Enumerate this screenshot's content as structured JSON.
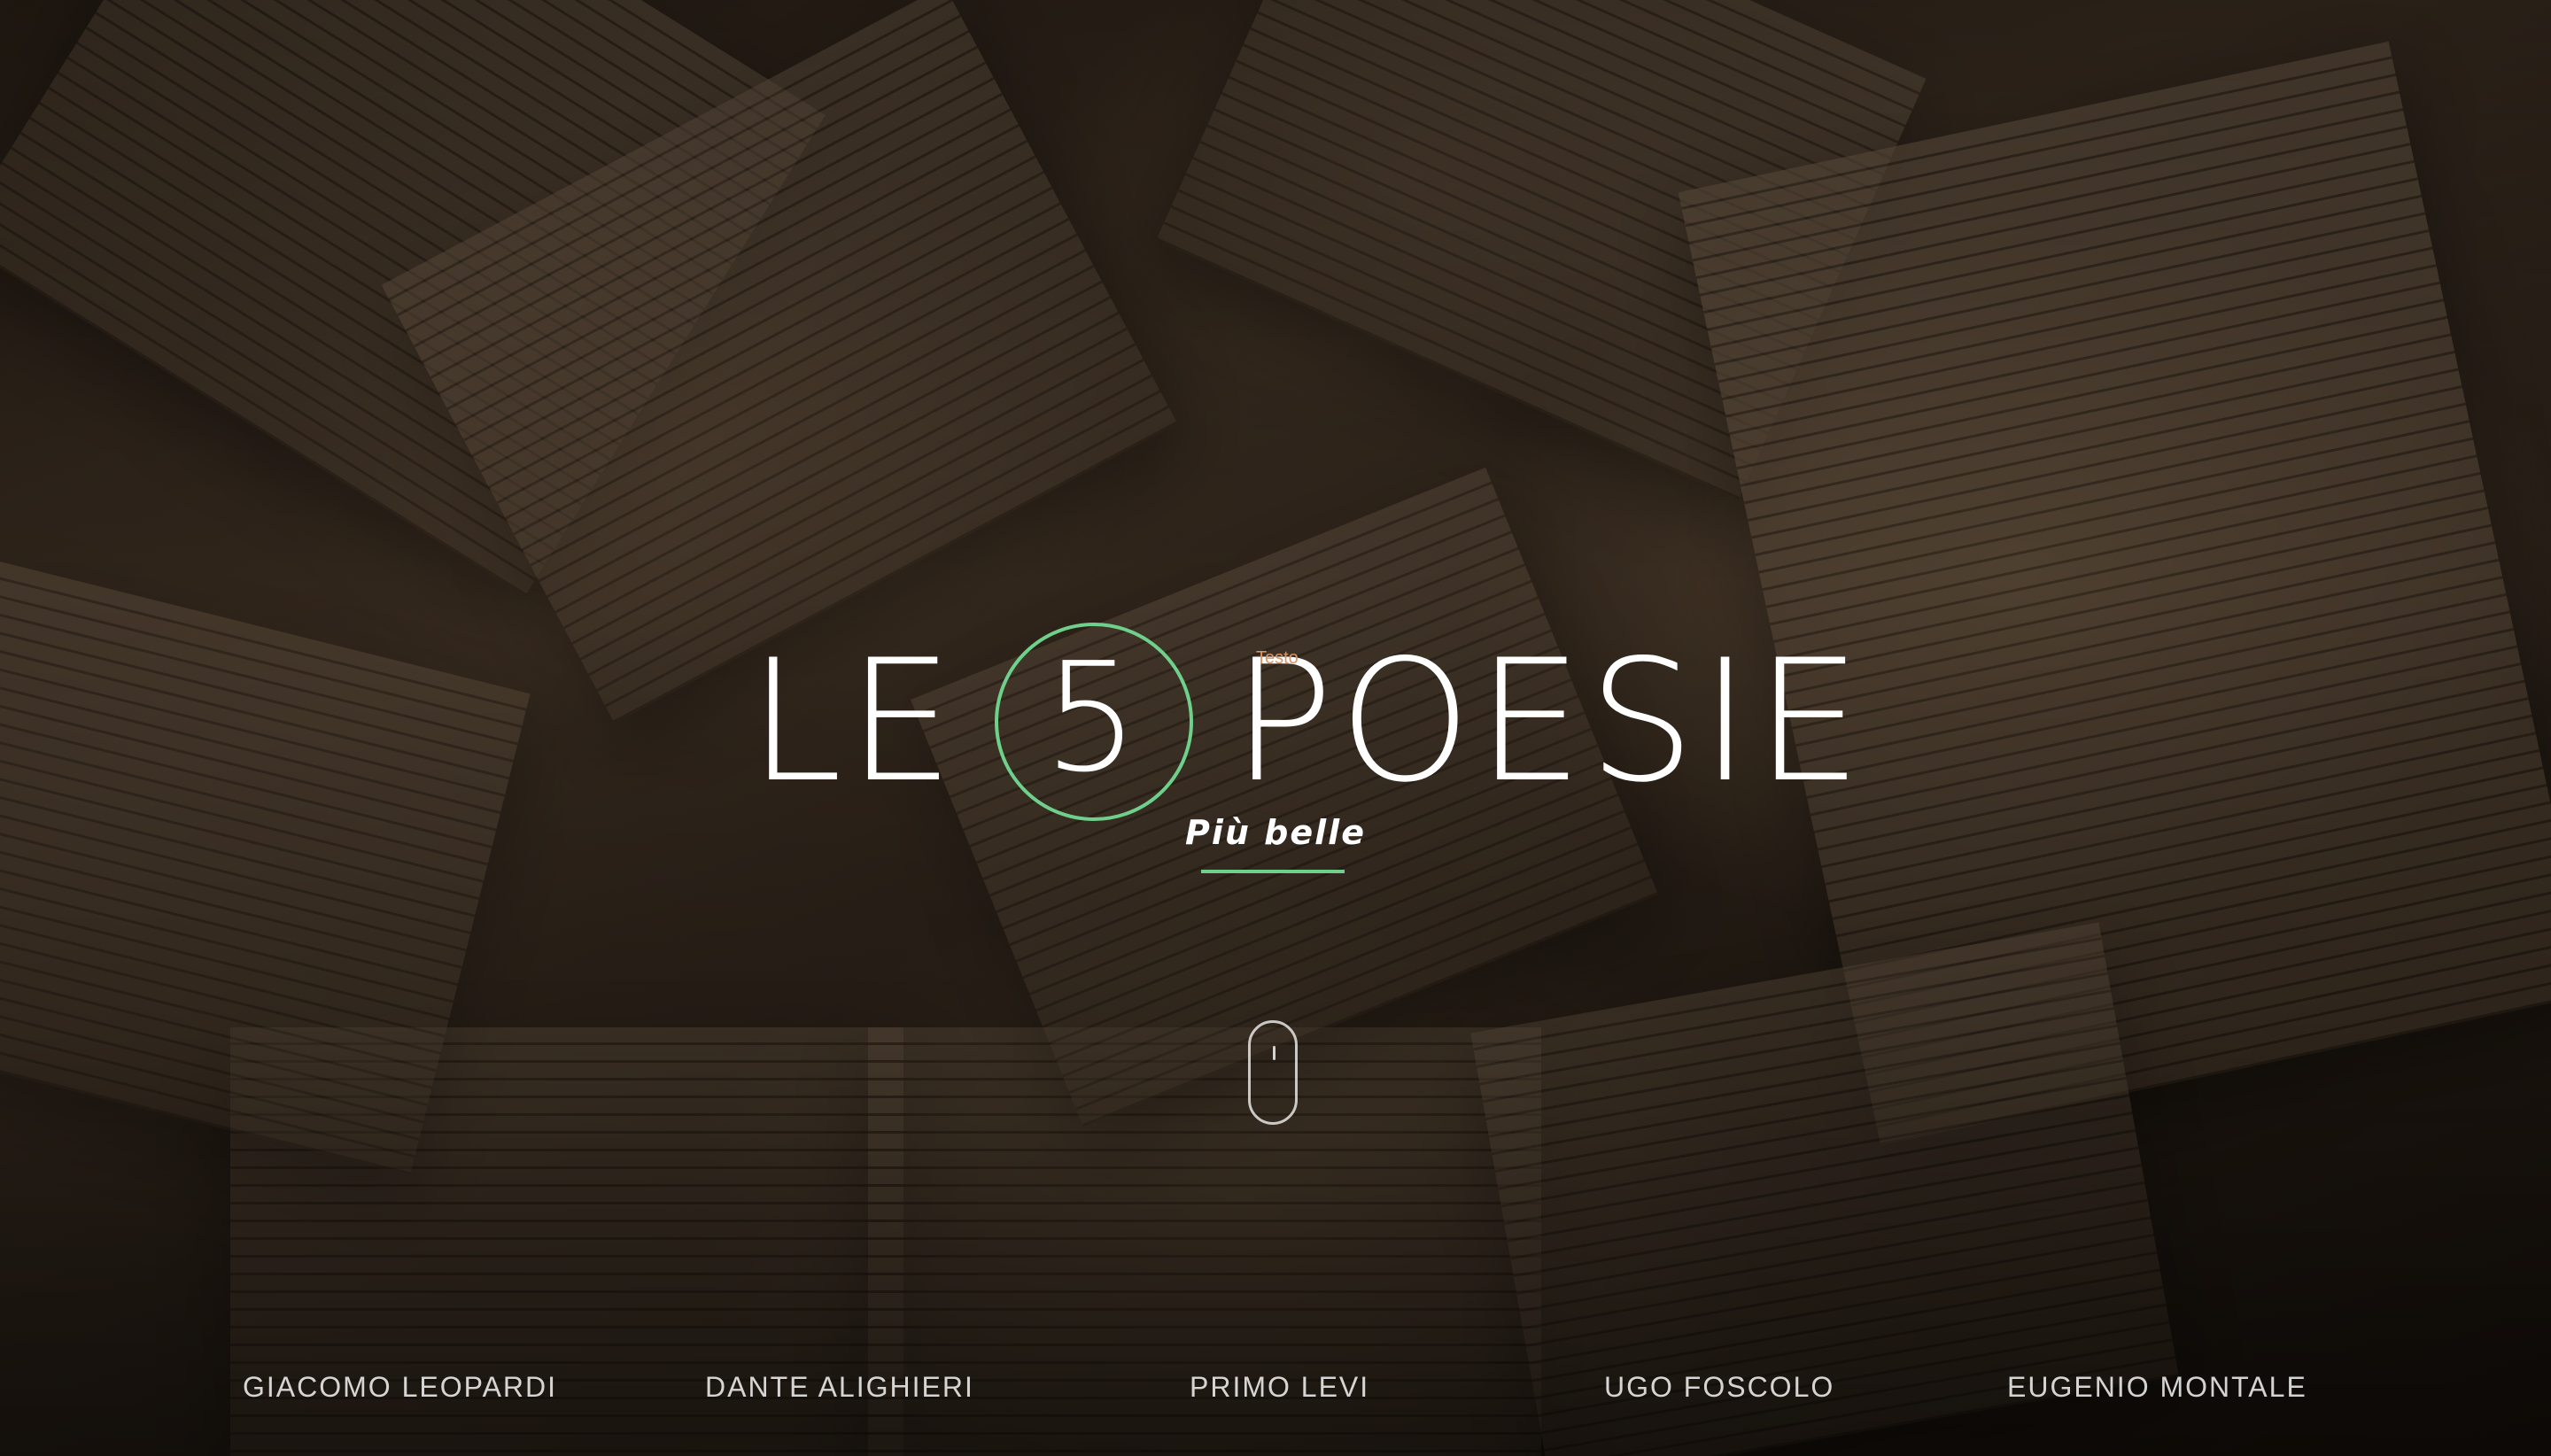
{
  "hero": {
    "title_left": "LE",
    "title_number": "5",
    "title_right": "POESIE",
    "tiny_label": "Testo",
    "subtitle": "Più belle",
    "accent_color": "#6fd08c"
  },
  "scroll_indicator": {
    "icon": "mouse-scroll-icon"
  },
  "nav": {
    "items": [
      {
        "label": "GIACOMO LEOPARDI"
      },
      {
        "label": "DANTE ALIGHIERI"
      },
      {
        "label": "PRIMO LEVI"
      },
      {
        "label": "UGO FOSCOLO"
      },
      {
        "label": "EUGENIO MONTALE"
      }
    ]
  }
}
